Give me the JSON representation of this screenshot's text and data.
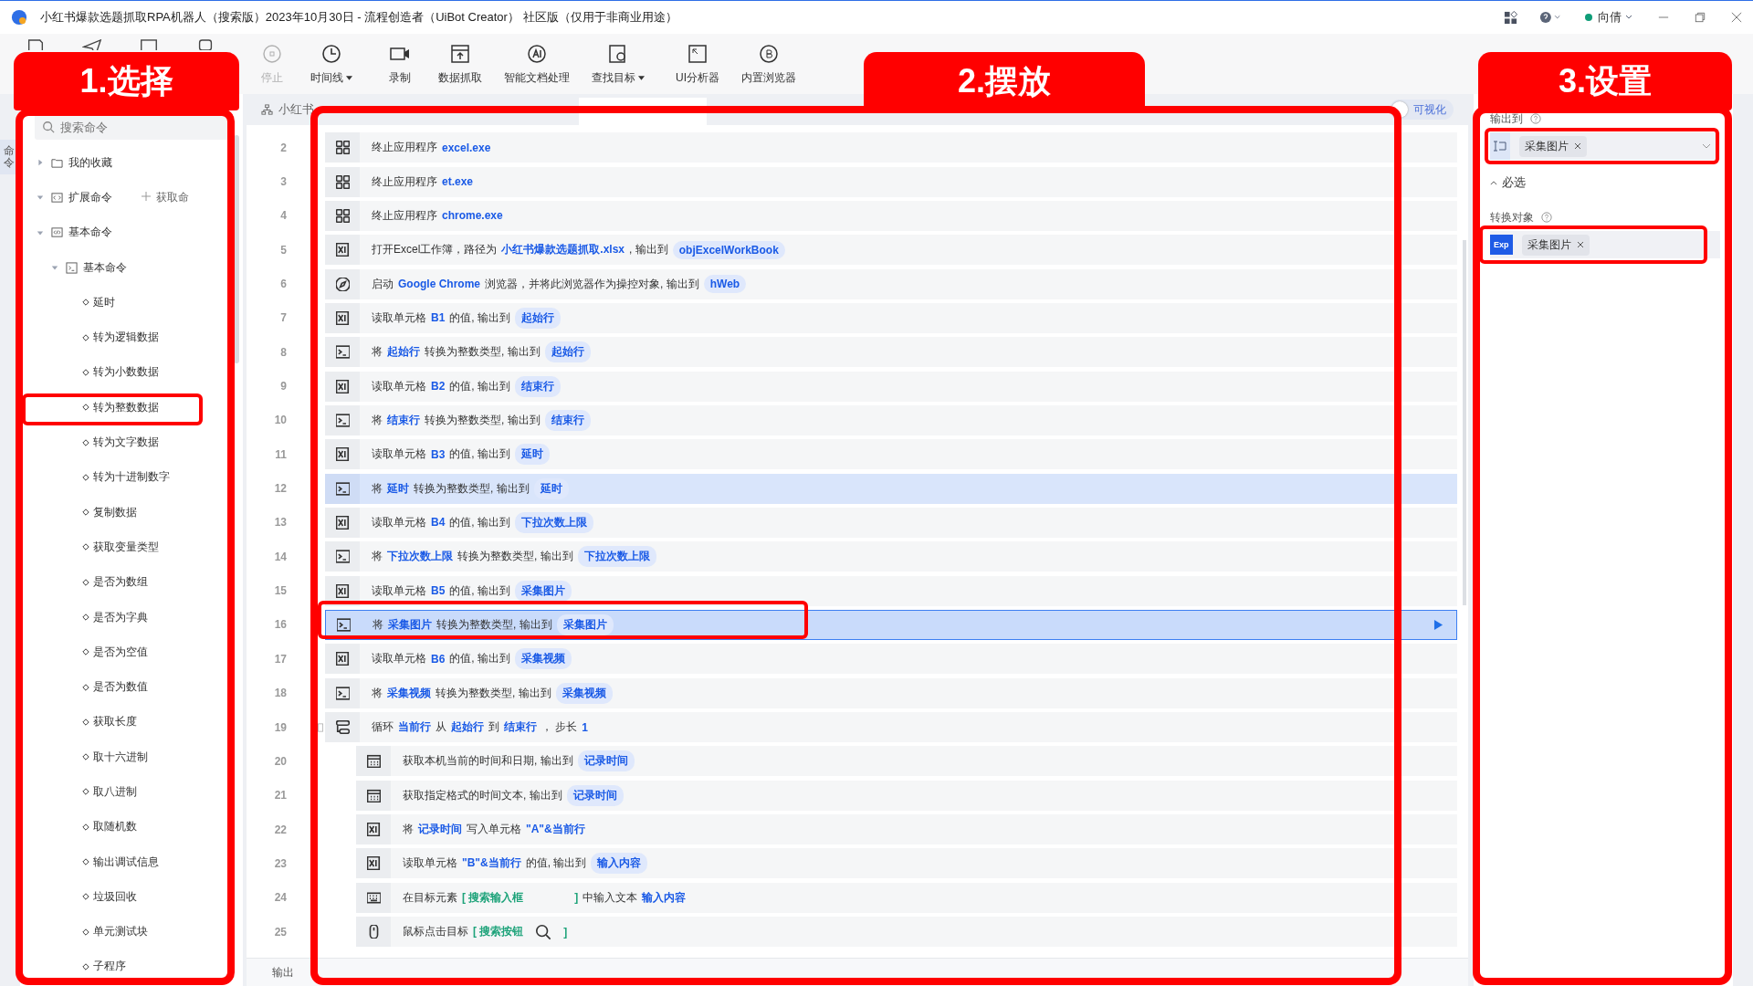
{
  "window": {
    "title": "小红书爆款选题抓取RPA机器人（搜索版）2023年10月30日 - 流程创造者（UiBot Creator） 社区版（仅用于非商业用途）",
    "user": "向倩"
  },
  "toolbar": [
    {
      "label": "停止",
      "kind": "stop",
      "disabled": true,
      "menu": false
    },
    {
      "label": "时间线",
      "kind": "clock",
      "disabled": false,
      "menu": true
    },
    {
      "label": "录制",
      "kind": "record",
      "disabled": false,
      "menu": false
    },
    {
      "label": "数据抓取",
      "kind": "scrape",
      "disabled": false,
      "menu": false
    },
    {
      "label": "智能文档处理",
      "kind": "ai",
      "disabled": false,
      "menu": false
    },
    {
      "label": "查找目标",
      "kind": "find",
      "disabled": false,
      "menu": true
    },
    {
      "label": "UI分析器",
      "kind": "ui",
      "disabled": false,
      "menu": false
    },
    {
      "label": "内置浏览器",
      "kind": "browser",
      "disabled": false,
      "menu": false
    }
  ],
  "side_tab": "命令",
  "commands": {
    "search_placeholder": "搜索命令",
    "get_more": "获取命",
    "tree": [
      {
        "label": "我的收藏",
        "kind": "folder",
        "expanded": false
      },
      {
        "label": "扩展命令",
        "kind": "ext",
        "expanded": true
      },
      {
        "label": "基本命令",
        "kind": "code",
        "expanded": true,
        "children": [
          {
            "label": "基本命令",
            "kind": "term",
            "expanded": true,
            "children": [
              {
                "label": "延时",
                "kind": "leaf"
              },
              {
                "label": "转为逻辑数据",
                "kind": "leaf"
              },
              {
                "label": "转为小数数据",
                "kind": "leaf"
              },
              {
                "label": "转为整数数据",
                "kind": "leaf"
              },
              {
                "label": "转为文字数据",
                "kind": "leaf"
              },
              {
                "label": "转为十进制数字",
                "kind": "leaf"
              },
              {
                "label": "复制数据",
                "kind": "leaf"
              },
              {
                "label": "获取变量类型",
                "kind": "leaf"
              },
              {
                "label": "是否为数组",
                "kind": "leaf"
              },
              {
                "label": "是否为字典",
                "kind": "leaf"
              },
              {
                "label": "是否为空值",
                "kind": "leaf"
              },
              {
                "label": "是否为数值",
                "kind": "leaf"
              },
              {
                "label": "获取长度",
                "kind": "leaf"
              },
              {
                "label": "取十六进制",
                "kind": "leaf"
              },
              {
                "label": "取八进制",
                "kind": "leaf"
              },
              {
                "label": "取随机数",
                "kind": "leaf"
              },
              {
                "label": "输出调试信息",
                "kind": "leaf"
              },
              {
                "label": "垃圾回收",
                "kind": "leaf"
              },
              {
                "label": "单元测试块",
                "kind": "leaf"
              },
              {
                "label": "子程序",
                "kind": "leaf"
              }
            ]
          }
        ]
      }
    ]
  },
  "editor": {
    "tab": "小红书",
    "visual": {
      "label": "可视化",
      "on": false
    },
    "output_tab": "输出",
    "lines": [
      {
        "num": "2",
        "kind": "app",
        "nested": false,
        "highlighted": false,
        "selected": false,
        "parts": [
          {
            "kind": "text",
            "text": "终止应用程序"
          },
          {
            "kind": "variable",
            "text": "excel.exe"
          }
        ]
      },
      {
        "num": "3",
        "kind": "app",
        "nested": false,
        "highlighted": false,
        "selected": false,
        "parts": [
          {
            "kind": "text",
            "text": "终止应用程序"
          },
          {
            "kind": "variable",
            "text": "et.exe"
          }
        ]
      },
      {
        "num": "4",
        "kind": "app",
        "nested": false,
        "highlighted": false,
        "selected": false,
        "parts": [
          {
            "kind": "text",
            "text": "终止应用程序"
          },
          {
            "kind": "variable",
            "text": "chrome.exe"
          }
        ]
      },
      {
        "num": "5",
        "kind": "excel",
        "nested": false,
        "highlighted": false,
        "selected": false,
        "parts": [
          {
            "kind": "text",
            "text": "打开Excel工作簿，路径为"
          },
          {
            "kind": "variable",
            "text": "小红书爆款选题抓取.xlsx"
          },
          {
            "kind": "text",
            "text": ", 输出到"
          },
          {
            "kind": "tag",
            "text": "objExcelWorkBook"
          }
        ]
      },
      {
        "num": "6",
        "kind": "browser",
        "nested": false,
        "highlighted": false,
        "selected": false,
        "parts": [
          {
            "kind": "text",
            "text": "启动"
          },
          {
            "kind": "variable",
            "text": "Google Chrome"
          },
          {
            "kind": "text",
            "text": "浏览器，并将此浏览器作为操控对象, 输出到"
          },
          {
            "kind": "tag",
            "text": "hWeb"
          }
        ]
      },
      {
        "num": "7",
        "kind": "excel",
        "nested": false,
        "highlighted": false,
        "selected": false,
        "parts": [
          {
            "kind": "text",
            "text": "读取单元格"
          },
          {
            "kind": "variable",
            "text": "B1"
          },
          {
            "kind": "text",
            "text": "的值, 输出到"
          },
          {
            "kind": "tag",
            "text": "起始行"
          }
        ]
      },
      {
        "num": "8",
        "kind": "convert",
        "nested": false,
        "highlighted": false,
        "selected": false,
        "parts": [
          {
            "kind": "text",
            "text": "将"
          },
          {
            "kind": "variable",
            "text": "起始行"
          },
          {
            "kind": "text",
            "text": "转换为整数类型, 输出到"
          },
          {
            "kind": "tag",
            "text": "起始行"
          }
        ]
      },
      {
        "num": "9",
        "kind": "excel",
        "nested": false,
        "highlighted": false,
        "selected": false,
        "parts": [
          {
            "kind": "text",
            "text": "读取单元格"
          },
          {
            "kind": "variable",
            "text": "B2"
          },
          {
            "kind": "text",
            "text": "的值, 输出到"
          },
          {
            "kind": "tag",
            "text": "结束行"
          }
        ]
      },
      {
        "num": "10",
        "kind": "convert",
        "nested": false,
        "highlighted": false,
        "selected": false,
        "parts": [
          {
            "kind": "text",
            "text": "将"
          },
          {
            "kind": "variable",
            "text": "结束行"
          },
          {
            "kind": "text",
            "text": "转换为整数类型, 输出到"
          },
          {
            "kind": "tag",
            "text": "结束行"
          }
        ]
      },
      {
        "num": "11",
        "kind": "excel",
        "nested": false,
        "highlighted": false,
        "selected": false,
        "parts": [
          {
            "kind": "text",
            "text": "读取单元格"
          },
          {
            "kind": "variable",
            "text": "B3"
          },
          {
            "kind": "text",
            "text": "的值, 输出到"
          },
          {
            "kind": "tag",
            "text": "延时"
          }
        ]
      },
      {
        "num": "12",
        "kind": "convert",
        "nested": false,
        "highlighted": true,
        "selected": false,
        "parts": [
          {
            "kind": "text",
            "text": "将"
          },
          {
            "kind": "variable",
            "text": "延时"
          },
          {
            "kind": "text",
            "text": "转换为整数类型, 输出到"
          },
          {
            "kind": "tag",
            "text": "延时"
          }
        ]
      },
      {
        "num": "13",
        "kind": "excel",
        "nested": false,
        "highlighted": false,
        "selected": false,
        "parts": [
          {
            "kind": "text",
            "text": "读取单元格"
          },
          {
            "kind": "variable",
            "text": "B4"
          },
          {
            "kind": "text",
            "text": "的值, 输出到"
          },
          {
            "kind": "tag",
            "text": "下拉次数上限"
          }
        ]
      },
      {
        "num": "14",
        "kind": "convert",
        "nested": false,
        "highlighted": false,
        "selected": false,
        "parts": [
          {
            "kind": "text",
            "text": "将"
          },
          {
            "kind": "variable",
            "text": "下拉次数上限"
          },
          {
            "kind": "text",
            "text": "转换为整数类型, 输出到"
          },
          {
            "kind": "tag",
            "text": "下拉次数上限"
          }
        ]
      },
      {
        "num": "15",
        "kind": "excel",
        "nested": false,
        "highlighted": false,
        "selected": false,
        "parts": [
          {
            "kind": "text",
            "text": "读取单元格"
          },
          {
            "kind": "variable",
            "text": "B5"
          },
          {
            "kind": "text",
            "text": "的值, 输出到"
          },
          {
            "kind": "tag",
            "text": "采集图片"
          }
        ]
      },
      {
        "num": "16",
        "kind": "convert",
        "nested": false,
        "highlighted": false,
        "selected": true,
        "parts": [
          {
            "kind": "text",
            "text": "将"
          },
          {
            "kind": "variable",
            "text": "采集图片"
          },
          {
            "kind": "text",
            "text": "转换为整数类型, 输出到"
          },
          {
            "kind": "tag",
            "text": "采集图片"
          }
        ]
      },
      {
        "num": "17",
        "kind": "excel",
        "nested": false,
        "highlighted": false,
        "selected": false,
        "parts": [
          {
            "kind": "text",
            "text": "读取单元格"
          },
          {
            "kind": "variable",
            "text": "B6"
          },
          {
            "kind": "text",
            "text": "的值, 输出到"
          },
          {
            "kind": "tag",
            "text": "采集视频"
          }
        ]
      },
      {
        "num": "18",
        "kind": "convert",
        "nested": false,
        "highlighted": false,
        "selected": false,
        "parts": [
          {
            "kind": "text",
            "text": "将"
          },
          {
            "kind": "variable",
            "text": "采集视频"
          },
          {
            "kind": "text",
            "text": "转换为整数类型, 输出到"
          },
          {
            "kind": "tag",
            "text": "采集视频"
          }
        ]
      },
      {
        "num": "19",
        "kind": "loop",
        "nested": false,
        "highlighted": false,
        "selected": false,
        "parts": [
          {
            "kind": "text",
            "text": "循环"
          },
          {
            "kind": "variable",
            "text": "当前行"
          },
          {
            "kind": "text",
            "text": "从"
          },
          {
            "kind": "variable",
            "text": "起始行"
          },
          {
            "kind": "text",
            "text": "到"
          },
          {
            "kind": "variable",
            "text": "结束行"
          },
          {
            "kind": "text",
            "text": "，  步长"
          },
          {
            "kind": "variable",
            "text": "1"
          }
        ]
      },
      {
        "num": "20",
        "kind": "time",
        "nested": true,
        "highlighted": false,
        "selected": false,
        "parts": [
          {
            "kind": "text",
            "text": "获取本机当前的时间和日期, 输出到"
          },
          {
            "kind": "tag",
            "text": "记录时间"
          }
        ]
      },
      {
        "num": "21",
        "kind": "time",
        "nested": true,
        "highlighted": false,
        "selected": false,
        "parts": [
          {
            "kind": "text",
            "text": "获取指定格式的时间文本, 输出到"
          },
          {
            "kind": "tag",
            "text": "记录时间"
          }
        ]
      },
      {
        "num": "22",
        "kind": "excel",
        "nested": true,
        "highlighted": false,
        "selected": false,
        "parts": [
          {
            "kind": "text",
            "text": "将"
          },
          {
            "kind": "variable",
            "text": "记录时间"
          },
          {
            "kind": "text",
            "text": "写入单元格"
          },
          {
            "kind": "variable",
            "text": "\"A\"&当前行"
          }
        ]
      },
      {
        "num": "23",
        "kind": "excel",
        "nested": true,
        "highlighted": false,
        "selected": false,
        "parts": [
          {
            "kind": "text",
            "text": "读取单元格"
          },
          {
            "kind": "variable",
            "text": "\"B\"&当前行"
          },
          {
            "kind": "text",
            "text": "的值, 输出到"
          },
          {
            "kind": "tag",
            "text": "输入内容"
          }
        ]
      },
      {
        "num": "24",
        "kind": "input",
        "nested": true,
        "highlighted": false,
        "selected": false,
        "parts": [
          {
            "kind": "text",
            "text": "在目标元素"
          },
          {
            "kind": "target",
            "text": "[ 搜索输入框"
          },
          {
            "kind": "gap"
          },
          {
            "kind": "target",
            "text": "]"
          },
          {
            "kind": "text",
            "text": "中输入文本"
          },
          {
            "kind": "variable",
            "text": "输入内容"
          }
        ]
      },
      {
        "num": "25",
        "kind": "click",
        "nested": true,
        "highlighted": false,
        "selected": false,
        "parts": [
          {
            "kind": "text",
            "text": "鼠标点击目标"
          },
          {
            "kind": "target",
            "text": "[ 搜索按钮"
          },
          {
            "kind": "picture"
          },
          {
            "kind": "target",
            "text": "]"
          }
        ]
      }
    ]
  },
  "properties": {
    "output_label": "输出到",
    "output_value": "采集图片",
    "section": {
      "label": "必选",
      "expanded": true
    },
    "object_label": "转换对象",
    "object_badge": "Exp",
    "object_value": "采集图片"
  },
  "annotations": [
    {
      "label": "1.选择"
    },
    {
      "label": "2.摆放"
    },
    {
      "label": "3.设置"
    }
  ]
}
